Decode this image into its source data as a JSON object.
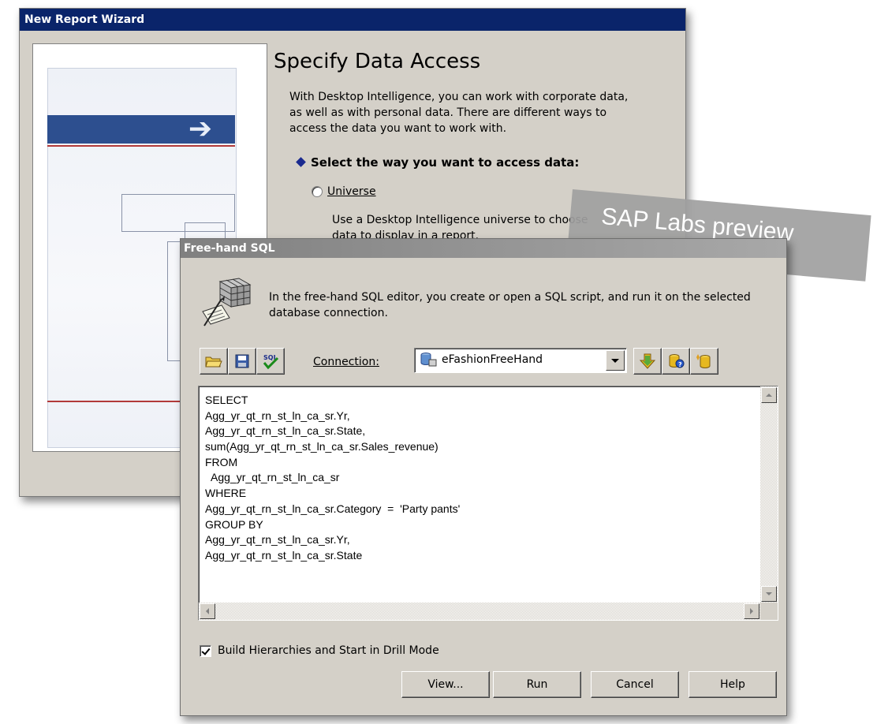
{
  "wizard": {
    "title": "New Report Wizard",
    "heading": "Specify Data Access",
    "intro": "With Desktop Intelligence, you can work with corporate data, as well as with personal data. There are different ways to access the data you want to work with.",
    "select_prompt": "Select the way you want to access data:",
    "option_universe_label": "Universe",
    "option_universe_desc": "Use a Desktop Intelligence universe to choose data to display in a report."
  },
  "watermark": {
    "text": "SAP Labs preview"
  },
  "dialog": {
    "title": "Free-hand SQL",
    "description": "In the free-hand SQL editor, you create or open a SQL script, and run it on the selected database connection.",
    "toolbar": {
      "icons": [
        "open-folder-icon",
        "save-disk-icon",
        "sql-check-icon"
      ],
      "connection_label": "Connection:",
      "connection_value": "eFashionFreeHand",
      "connection_icons": [
        "download-arrow-icon",
        "database-properties-icon",
        "new-connection-icon"
      ]
    },
    "sql_lines": [
      "SELECT",
      "Agg_yr_qt_rn_st_ln_ca_sr.Yr,",
      "Agg_yr_qt_rn_st_ln_ca_sr.State,",
      "sum(Agg_yr_qt_rn_st_ln_ca_sr.Sales_revenue)",
      "FROM",
      "  Agg_yr_qt_rn_st_ln_ca_sr",
      "WHERE",
      "Agg_yr_qt_rn_st_ln_ca_sr.Category  =  'Party pants'",
      "GROUP BY",
      "Agg_yr_qt_rn_st_ln_ca_sr.Yr,",
      "Agg_yr_qt_rn_st_ln_ca_sr.State"
    ],
    "checkbox_label": "Build Hierarchies and Start in Drill Mode",
    "checkbox_checked": true,
    "buttons": {
      "view": "View...",
      "run": "Run",
      "cancel": "Cancel",
      "help": "Help"
    }
  },
  "colors": {
    "wizard_title_bar": "#0a246a",
    "dialog_title_bar": "#808080",
    "window_face": "#d4d0c8",
    "watermark": "#a0a0a0",
    "accent_diamond": "#1a2a8f"
  }
}
